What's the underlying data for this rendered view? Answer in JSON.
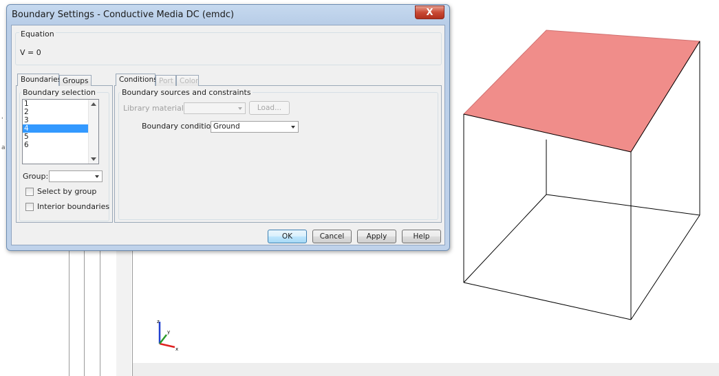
{
  "dialog": {
    "title": "Boundary Settings - Conductive Media DC (emdc)",
    "close_glyph": "X"
  },
  "equation": {
    "group_label": "Equation",
    "text": "V = 0"
  },
  "left_tabs": [
    {
      "label": "Boundaries",
      "active": true
    },
    {
      "label": "Groups",
      "active": false
    }
  ],
  "boundary_selection": {
    "label": "Boundary selection",
    "items": [
      "1",
      "2",
      "3",
      "4",
      "5",
      "6"
    ],
    "selected": "4"
  },
  "group": {
    "label": "Group:",
    "value": ""
  },
  "checkboxes": {
    "select_by_group": "Select by group",
    "interior_boundaries": "Interior boundaries"
  },
  "right_tabs": [
    {
      "label": "Conditions",
      "enabled": true
    },
    {
      "label": "Port",
      "enabled": false
    },
    {
      "label": "Color",
      "enabled": false
    }
  ],
  "sources": {
    "group_label": "Boundary sources and constraints",
    "library_material_label": "Library material:",
    "library_material_value": "",
    "load_button": "Load...",
    "boundary_condition_label": "Boundary condition:",
    "boundary_condition_value": "Ground"
  },
  "buttons": {
    "ok": "OK",
    "cancel": "Cancel",
    "apply": "Apply",
    "help": "Help"
  },
  "axes": {
    "z": "z",
    "y": "y",
    "x": "x"
  },
  "colors": {
    "highlighted_face": "#f08d8a",
    "selection": "#3399ff",
    "axis_x": "#e02020",
    "axis_y": "#2a9a2a",
    "axis_z": "#2040d0"
  }
}
